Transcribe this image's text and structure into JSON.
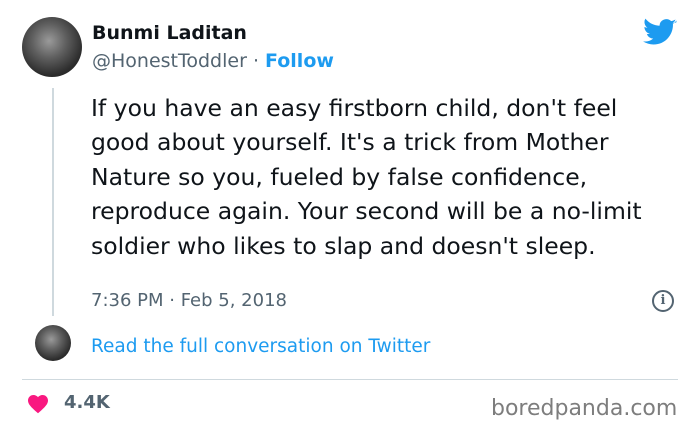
{
  "author": {
    "name": "Bunmi Laditan",
    "handle": "@HonestToddler",
    "separator": " · ",
    "follow_label": "Follow"
  },
  "tweet": {
    "text": "If you have an easy firstborn child, don't feel good about yourself. It's a trick from Mother Nature so you, fueled by false confidence, reproduce again. Your second will be a no-limit soldier who likes to slap and doesn't sleep.",
    "timestamp": "7:36 PM · Feb 5, 2018"
  },
  "conversation": {
    "link_label": "Read the full conversation on Twitter"
  },
  "engagement": {
    "likes": "4.4K"
  },
  "watermark": "boredpanda.com",
  "icons": {
    "brand": "twitter-bird-icon",
    "info": "info-icon",
    "like": "heart-icon"
  },
  "colors": {
    "twitter_blue": "#1d9bf0",
    "heart_red": "#f91880",
    "text": "#0f1419",
    "secondary": "#536471"
  }
}
